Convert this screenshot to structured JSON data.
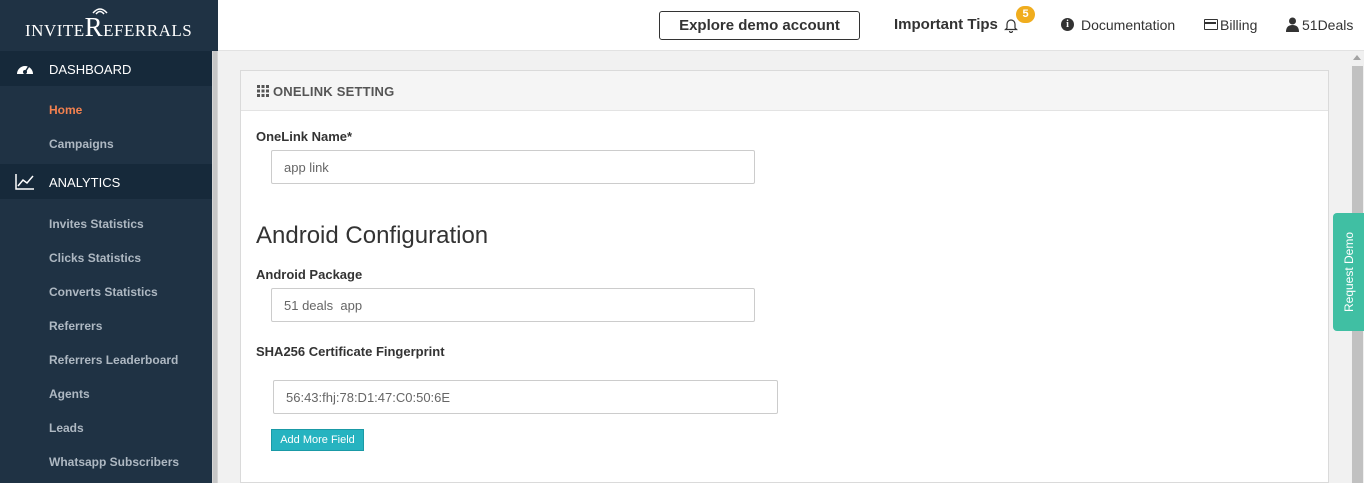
{
  "brand": {
    "small1": "INVITE",
    "big": "R",
    "small2": "EFERRALS"
  },
  "sidebar": {
    "sections": [
      {
        "label": "DASHBOARD",
        "icon": "dashboard-icon"
      },
      {
        "label": "ANALYTICS",
        "icon": "line-chart-icon"
      }
    ],
    "dashboard_items": [
      {
        "label": "Home",
        "active": true
      },
      {
        "label": "Campaigns"
      }
    ],
    "analytics_items": [
      {
        "label": "Invites Statistics"
      },
      {
        "label": "Clicks Statistics"
      },
      {
        "label": "Converts Statistics"
      },
      {
        "label": "Referrers"
      },
      {
        "label": "Referrers Leaderboard"
      },
      {
        "label": "Agents"
      },
      {
        "label": "Leads"
      },
      {
        "label": "Whatsapp Subscribers"
      }
    ]
  },
  "header": {
    "demo_button": "Explore demo account",
    "tips": "Important Tips",
    "tips_count": "5",
    "documentation": "Documentation",
    "billing": "Billing",
    "user": "51Deals"
  },
  "panel": {
    "title": "ONELINK SETTING",
    "onelink_name_label": "OneLink Name*",
    "onelink_name_value": "app link",
    "android_heading": "Android Configuration",
    "android_package_label": "Android Package",
    "android_package_value": "51 deals  app",
    "sha_label": "SHA256 Certificate Fingerprint",
    "sha_value": "56:43:fhj:78:D1:47:C0:50:6E",
    "add_more": "Add More Field"
  },
  "request_demo": "Request Demo",
  "colors": {
    "sidebar": "#1f3244",
    "active": "#f3814f",
    "accent": "#26b3c0",
    "request_demo": "#40bfa3",
    "badge": "#f0ad1e"
  }
}
